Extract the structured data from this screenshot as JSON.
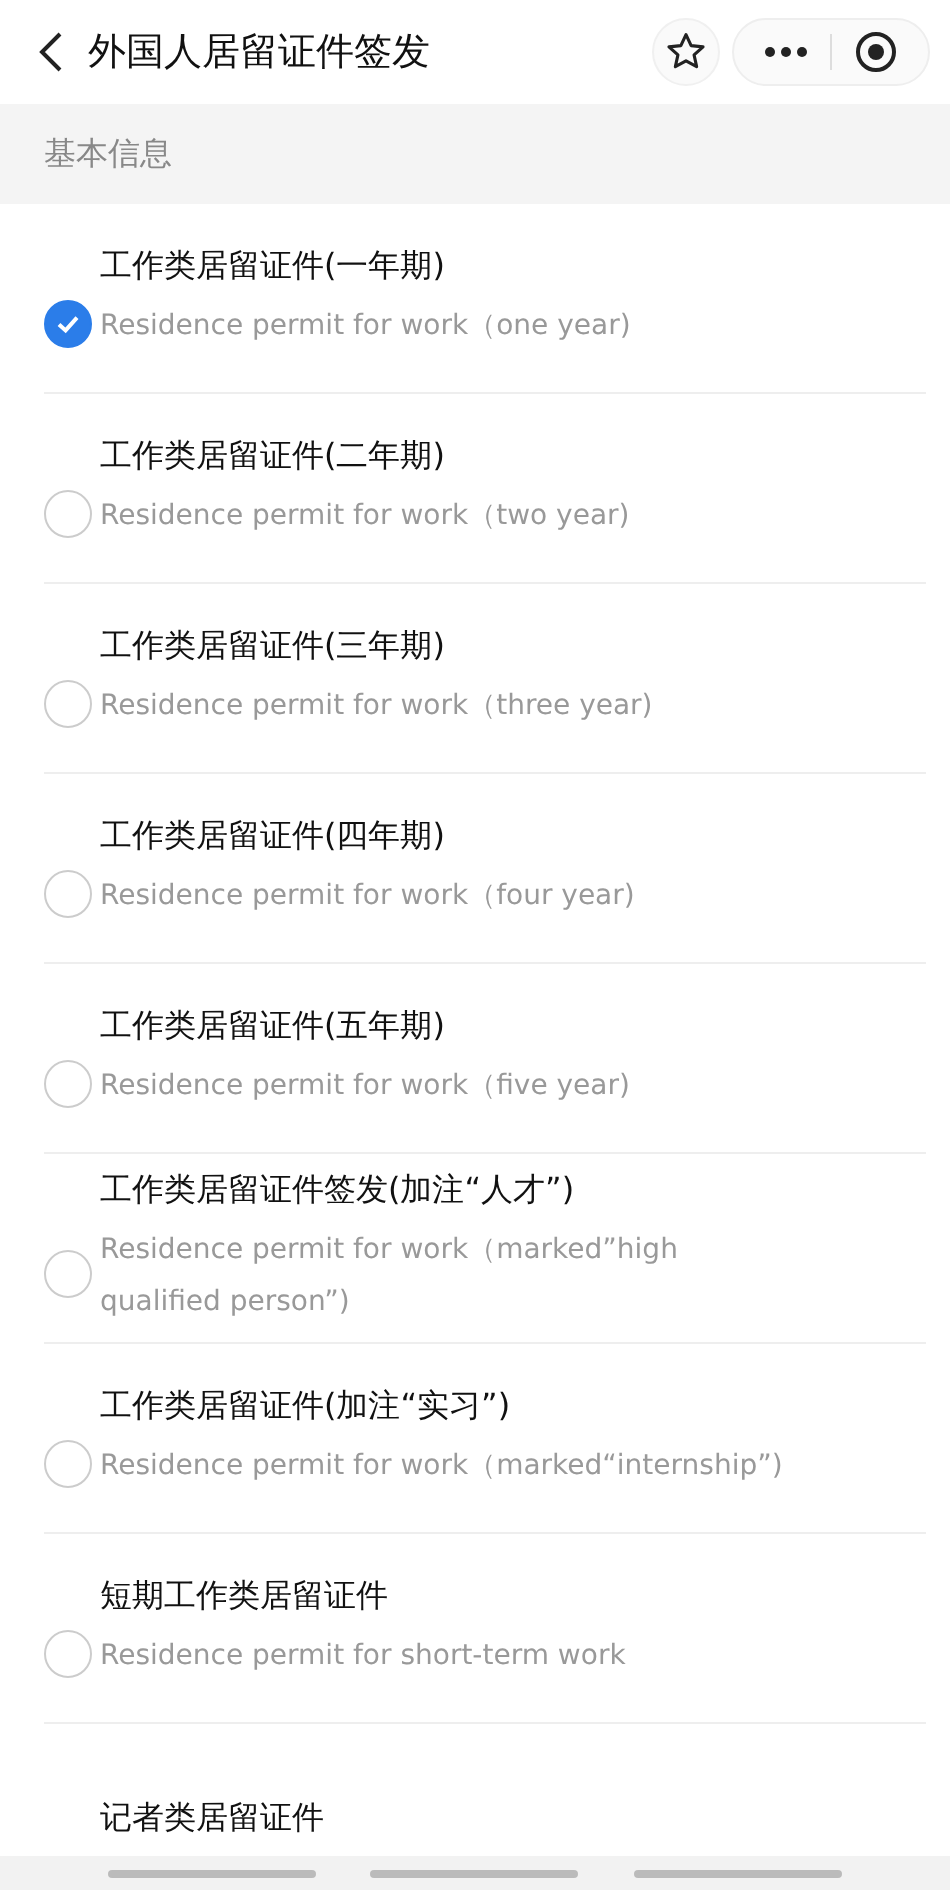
{
  "header": {
    "title": "外国人居留证件签发"
  },
  "section": {
    "title": "基本信息"
  },
  "options": [
    {
      "title": "工作类居留证件(一年期)",
      "subtitle": "Residence permit for work（one year)",
      "selected": true
    },
    {
      "title": "工作类居留证件(二年期)",
      "subtitle": "Residence permit for work（two year)",
      "selected": false
    },
    {
      "title": "工作类居留证件(三年期)",
      "subtitle": "Residence permit for work（three year)",
      "selected": false
    },
    {
      "title": "工作类居留证件(四年期)",
      "subtitle": "Residence permit for work（four year)",
      "selected": false
    },
    {
      "title": "工作类居留证件(五年期)",
      "subtitle": "Residence permit for work（five year)",
      "selected": false
    },
    {
      "title": "工作类居留证件签发(加注“人才”)",
      "subtitle": "Residence permit for work（marked”high qualified person”)",
      "selected": false
    },
    {
      "title": "工作类居留证件(加注“实习”)",
      "subtitle": "Residence permit for work（marked“internship”)",
      "selected": false
    },
    {
      "title": "短期工作类居留证件",
      "subtitle": "Residence permit for short-term work",
      "selected": false
    },
    {
      "title": "记者类居留证件"
    }
  ]
}
